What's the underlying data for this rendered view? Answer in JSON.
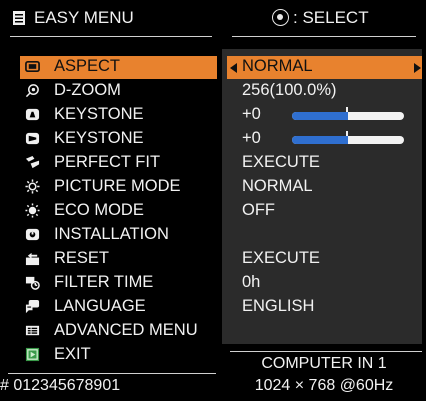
{
  "header": {
    "title": "EASY MENU",
    "select_hint": ": SELECT"
  },
  "menu": {
    "items": [
      {
        "label": "ASPECT",
        "value": "NORMAL",
        "icon": "aspect-icon",
        "selected": true
      },
      {
        "label": "D-ZOOM",
        "value": "256(100.0%)",
        "icon": "zoom-icon"
      },
      {
        "label": "KEYSTONE",
        "value": "+0",
        "icon": "keystone-vertical-icon",
        "slider": 0.5
      },
      {
        "label": "KEYSTONE",
        "value": "+0",
        "icon": "keystone-horizontal-icon",
        "slider": 0.5
      },
      {
        "label": "PERFECT FIT",
        "value": "EXECUTE",
        "icon": "perfect-fit-icon"
      },
      {
        "label": "PICTURE MODE",
        "value": "NORMAL",
        "icon": "picture-mode-icon"
      },
      {
        "label": "ECO MODE",
        "value": "OFF",
        "icon": "eco-mode-icon"
      },
      {
        "label": "INSTALLATION",
        "value": "",
        "icon": "installation-icon"
      },
      {
        "label": "RESET",
        "value": "EXECUTE",
        "icon": "reset-icon"
      },
      {
        "label": "FILTER TIME",
        "value": "0h",
        "icon": "filter-icon"
      },
      {
        "label": "LANGUAGE",
        "value": "ENGLISH",
        "icon": "language-icon"
      },
      {
        "label": "ADVANCED MENU",
        "value": "",
        "icon": "advanced-menu-icon"
      },
      {
        "label": "EXIT",
        "value": "",
        "icon": "exit-icon"
      }
    ]
  },
  "footer": {
    "serial": "# 012345678901",
    "source": "COMPUTER IN 1",
    "signal": "1024 × 768 @60Hz"
  },
  "colors": {
    "highlight": "#e8822e",
    "slider_fill": "#2f6fd0",
    "panel": "#2b2b2b",
    "background": "#000000"
  }
}
